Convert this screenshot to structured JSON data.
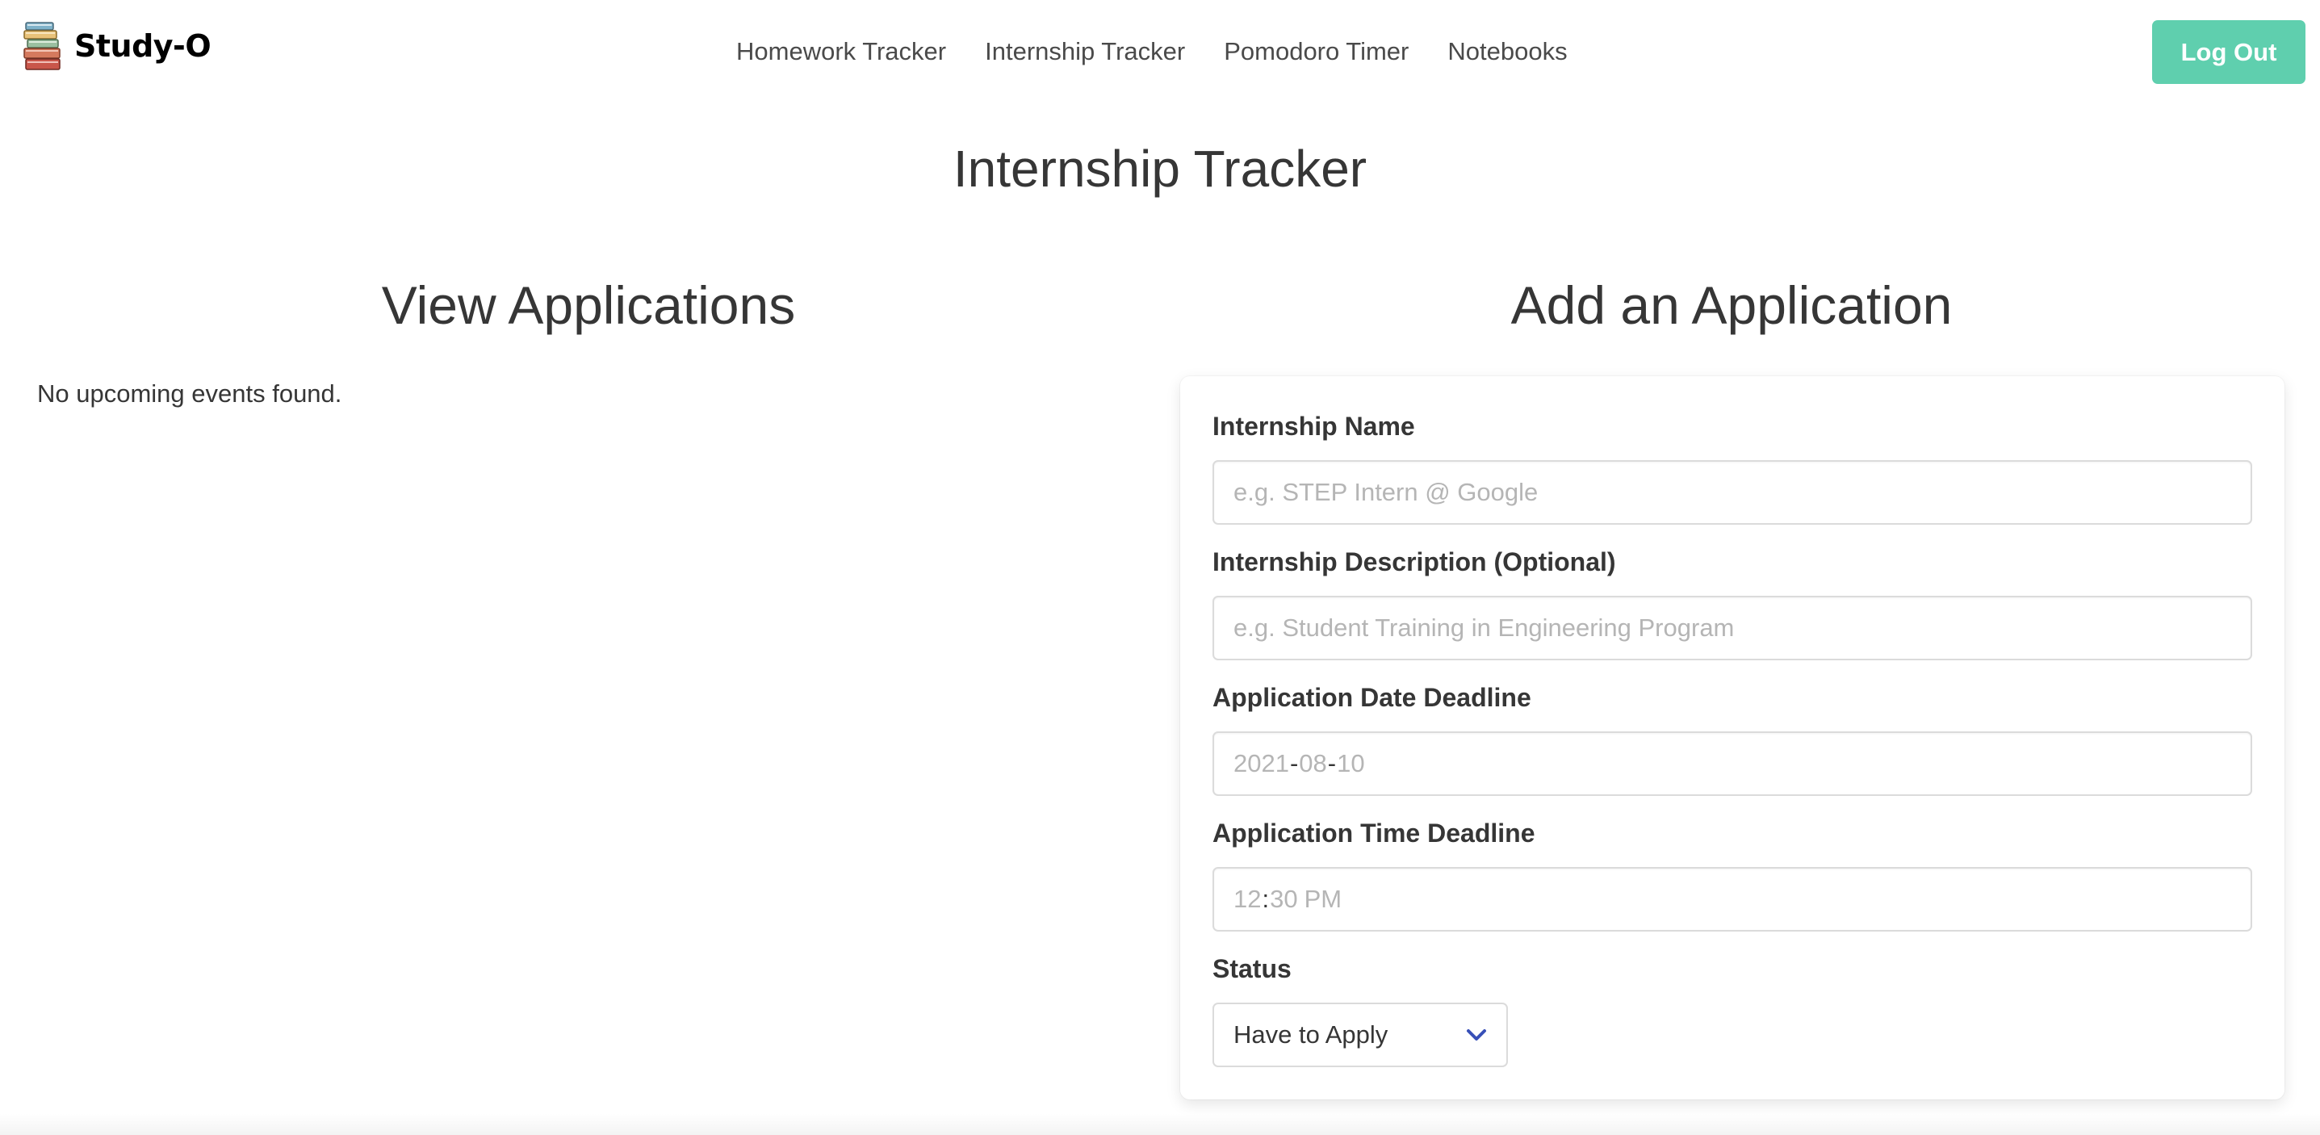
{
  "brand": {
    "name": "Study-O",
    "icon": "stacked-books-icon"
  },
  "nav": {
    "items": [
      {
        "label": "Homework Tracker"
      },
      {
        "label": "Internship Tracker"
      },
      {
        "label": "Pomodoro Timer"
      },
      {
        "label": "Notebooks"
      }
    ],
    "logout_label": "Log Out"
  },
  "page": {
    "title": "Internship Tracker"
  },
  "view_applications": {
    "title": "View Applications",
    "empty_message": "No upcoming events found."
  },
  "add_application": {
    "title": "Add an Application",
    "fields": {
      "name": {
        "label": "Internship Name",
        "placeholder": "e.g. STEP Intern @ Google",
        "value": ""
      },
      "description": {
        "label": "Internship Description (Optional)",
        "placeholder": "e.g. Student Training in Engineering Program",
        "value": ""
      },
      "date": {
        "label": "Application Date Deadline",
        "year": "2021",
        "month": "08",
        "day": "10"
      },
      "time": {
        "label": "Application Time Deadline",
        "hour": "12",
        "minute": "30",
        "period": "PM"
      },
      "status": {
        "label": "Status",
        "selected": "Have to Apply"
      }
    }
  },
  "colors": {
    "accent": "#5fcfae",
    "text": "#363636",
    "placeholder": "#b5b5b5",
    "border": "#dbdbdb",
    "chevron": "#3850b8"
  }
}
